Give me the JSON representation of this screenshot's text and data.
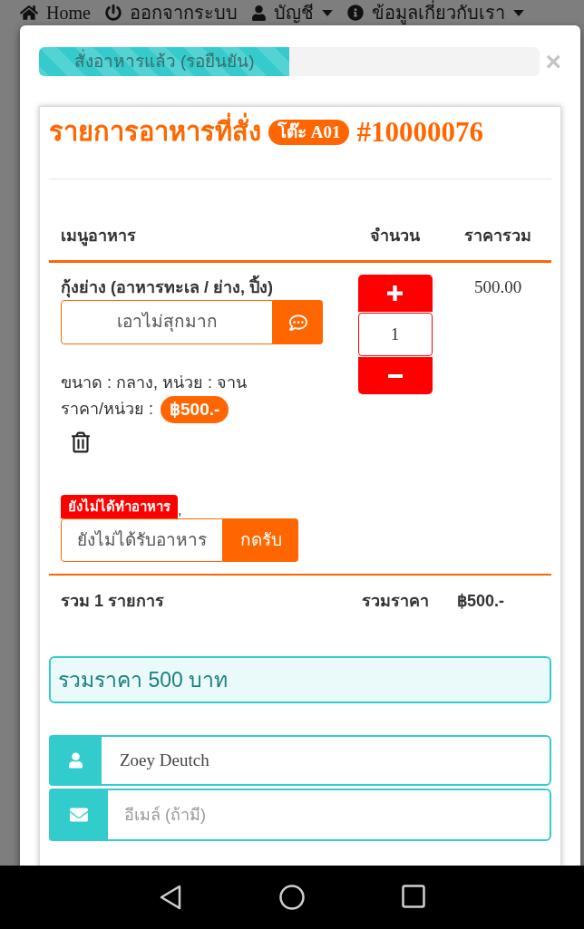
{
  "top_nav": {
    "items": [
      {
        "label": "Home",
        "dropdown": false
      },
      {
        "label": "ออกจากระบบ",
        "dropdown": false
      },
      {
        "label": "บัญชี",
        "dropdown": true
      },
      {
        "label": "ข้อมูลเกี่ยวกับเรา",
        "dropdown": true
      }
    ]
  },
  "modal": {
    "progress": {
      "label": "สั่งอาหารแล้ว (รอยืนยัน)",
      "level": 0.5
    },
    "close": "×",
    "order": {
      "title": "รายการอาหารที่สั่ง",
      "table": "โต๊ะ A01",
      "number": "#10000076",
      "columns": [
        "เมนูอาหาร",
        "จำนวน",
        "ราคารวม"
      ],
      "items": [
        {
          "name": "กุ้งย่าง (อาหารทะเล / ย่าง, ปิ้ง)",
          "note": "เอาไม่สุกมาก",
          "details": "ขนาด : กลาง, หน่วย : จาน",
          "unit_price_label": "ราคา/หน่วย :",
          "unit_price": "฿500.-",
          "status": "ยังไม่ได้ทำอาหาร",
          "status_suffix": ",",
          "receive_status": "ยังไม่ได้รับอาหาร",
          "receive_button": "กดรับ",
          "quantity": "1",
          "total": "500.00"
        }
      ],
      "summary": {
        "count": "รวม 1 รายการ",
        "total_label": "รวมราคา",
        "total": "฿500.-"
      },
      "total_notice": "รวมราคา 500 บาท",
      "customer": {
        "name": {
          "value": "Zoey Deutch"
        },
        "email": {
          "placeholder": "อีเมล์ (ถ้ามี)"
        }
      }
    }
  }
}
